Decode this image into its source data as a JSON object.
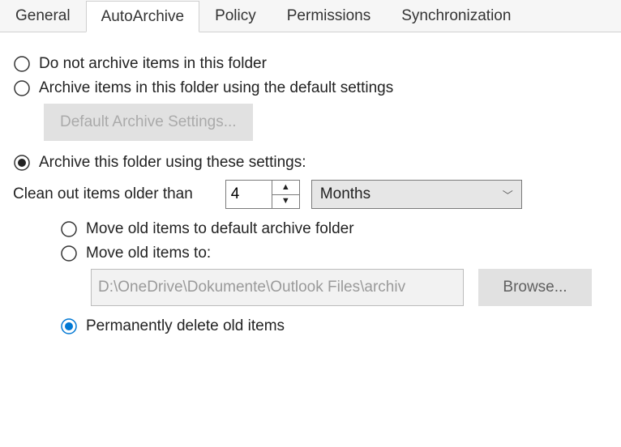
{
  "tabs": {
    "general": "General",
    "autoarchive": "AutoArchive",
    "policy": "Policy",
    "permissions": "Permissions",
    "synchronization": "Synchronization"
  },
  "options": {
    "do_not_archive": "Do not archive items in this folder",
    "use_default": "Archive items in this folder using the default settings",
    "default_settings_btn": "Default Archive Settings...",
    "use_these": "Archive this folder using these settings:",
    "clean_out_label": "Clean out items older than",
    "clean_out_value": "4",
    "unit_selected": "Months",
    "move_default": "Move old items to default archive folder",
    "move_to": "Move old items to:",
    "move_to_path": "D:\\OneDrive\\Dokumente\\Outlook Files\\archiv",
    "browse_btn": "Browse...",
    "perm_delete": "Permanently delete old items"
  }
}
